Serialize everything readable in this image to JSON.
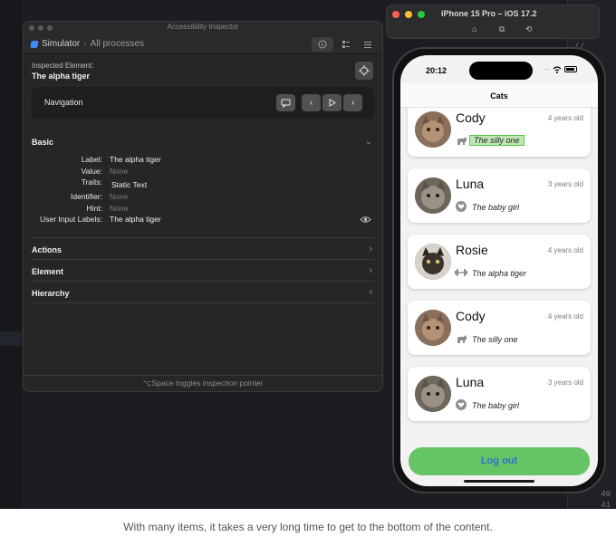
{
  "inspector": {
    "window_title": "Accessibility Inspector",
    "breadcrumb": {
      "app": "Simulator",
      "process": "All processes"
    },
    "inspected_label": "Inspected Element:",
    "inspected_value": "The alpha tiger",
    "navigation_label": "Navigation",
    "basic_title": "Basic",
    "attributes": [
      {
        "key": "Label:",
        "value": "The alpha tiger",
        "empty": false
      },
      {
        "key": "Value:",
        "value": "None",
        "empty": true
      },
      {
        "key": "Traits:",
        "value": "Static Text",
        "empty": false
      },
      {
        "key": "Identifier:",
        "value": "None",
        "empty": true
      },
      {
        "key": "Hint:",
        "value": "None",
        "empty": true
      },
      {
        "key": "User Input Labels:",
        "value": "The alpha tiger",
        "empty": false
      }
    ],
    "sections": [
      "Actions",
      "Element",
      "Hierarchy"
    ],
    "footer": "⌥Space toggles inspection pointer"
  },
  "simulator": {
    "window_title": "iPhone 15 Pro – iOS 17.2",
    "status_time": "20:12",
    "nav_title": "Cats",
    "cats": [
      {
        "name": "Cody",
        "age": "4 years old",
        "description": "The silly one",
        "icon": "cat-icon",
        "highlighted": true
      },
      {
        "name": "Luna",
        "age": "3 years old",
        "description": "The baby girl",
        "icon": "heart-icon",
        "highlighted": false
      },
      {
        "name": "Rosie",
        "age": "4 years old",
        "description": "The alpha tiger",
        "icon": "dumbbell-icon",
        "highlighted": false
      },
      {
        "name": "Cody",
        "age": "4 years old",
        "description": "The silly one",
        "icon": "cat-icon",
        "highlighted": false
      },
      {
        "name": "Luna",
        "age": "3 years old",
        "description": "The baby girl",
        "icon": "heart-icon",
        "highlighted": false
      }
    ],
    "logout_label": "Log out"
  },
  "editor": {
    "gutter_numbers": [
      "40",
      "41"
    ]
  },
  "caption": "With many items, it takes a very long time to get to the bottom of the content.",
  "colors": {
    "accent_green": "#67c465",
    "logout_text": "#2e6fd0",
    "highlight": "#bfe7b2"
  }
}
